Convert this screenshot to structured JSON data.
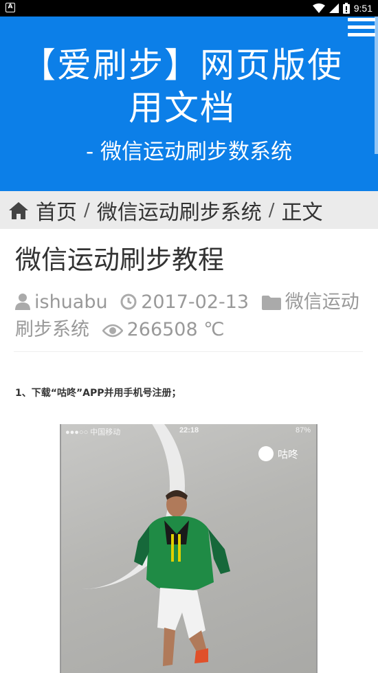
{
  "status_bar": {
    "left_glyph": "A",
    "time": "9:51",
    "icons": [
      "wifi-icon",
      "signal-icon",
      "battery-icon"
    ]
  },
  "header": {
    "title": "【爱刷步】网页版使用文档",
    "subtitle": "- 微信运动刷步数系统",
    "background_color": "#0c7fe8"
  },
  "breadcrumb": {
    "home": "首页",
    "separator": "/",
    "category": "微信运动刷步系统",
    "current": "正文"
  },
  "article": {
    "title": "微信运动刷步教程",
    "meta": {
      "author": "ishuabu",
      "date": "2017-02-13",
      "category": "微信运动刷步系统",
      "views": "266508 ℃"
    },
    "step1": "1、下载“咕咚”APP并用手机号注册；",
    "image": {
      "carrier": "●●●○○ 中国移动 ",
      "time": "22:18",
      "battery": "87%",
      "logo_text": "咕咚"
    }
  }
}
